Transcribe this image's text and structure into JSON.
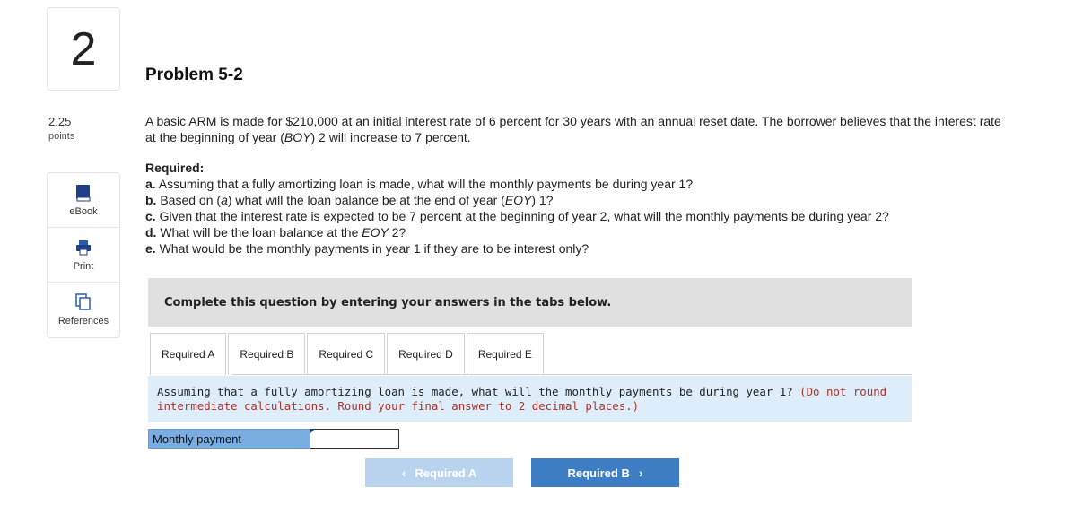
{
  "question_number": "2",
  "problem_title": "Problem 5-2",
  "points": {
    "value": "2.25",
    "label": "points"
  },
  "tools": [
    {
      "label": "eBook",
      "icon": "book-icon"
    },
    {
      "label": "Print",
      "icon": "printer-icon"
    },
    {
      "label": "References",
      "icon": "copy-icon"
    }
  ],
  "intro": {
    "part1": "A basic ARM is made for $210,000 at an initial interest rate of 6 percent for 30 years with an annual reset date. The borrower believes that the interest rate at the beginning of year (",
    "boy": "BOY",
    "part2": ") 2 will increase to 7 percent."
  },
  "required_heading": "Required:",
  "parts": {
    "a": {
      "letter": "a.",
      "text": " Assuming that a fully amortizing loan is made, what will the monthly payments be during year 1?"
    },
    "b": {
      "letter": "b.",
      "pre": " Based on (",
      "ref": "a",
      "mid": ") what will the loan balance be at the end of year (",
      "eoy": "EOY",
      "post": ") 1?"
    },
    "c": {
      "letter": "c.",
      "text": " Given that the interest rate is expected to be 7 percent at the beginning of year 2, what will the monthly payments be during year 2?"
    },
    "d": {
      "letter": "d.",
      "pre": " What will be the loan balance at the ",
      "eoy": "EOY",
      "post": " 2?"
    },
    "e": {
      "letter": "e.",
      "text": " What would be the monthly payments in year 1 if they are to be interest only?"
    }
  },
  "banner": "Complete this question by entering your answers in the tabs below.",
  "tabs": [
    "Required A",
    "Required B",
    "Required C",
    "Required D",
    "Required E"
  ],
  "active_tab": 0,
  "question_panel": {
    "text": "Assuming that a fully amortizing loan is made, what will the monthly payments be during year 1? ",
    "note": "(Do not round intermediate calculations. Round your final answer to 2 decimal places.)"
  },
  "answer": {
    "label": "Monthly payment",
    "value": ""
  },
  "nav": {
    "prev": "Required A",
    "next": "Required B"
  },
  "colors": {
    "tab_accent": "#3c7dc3",
    "note_red": "#b0312a",
    "panel_blue": "#ddeefa"
  }
}
